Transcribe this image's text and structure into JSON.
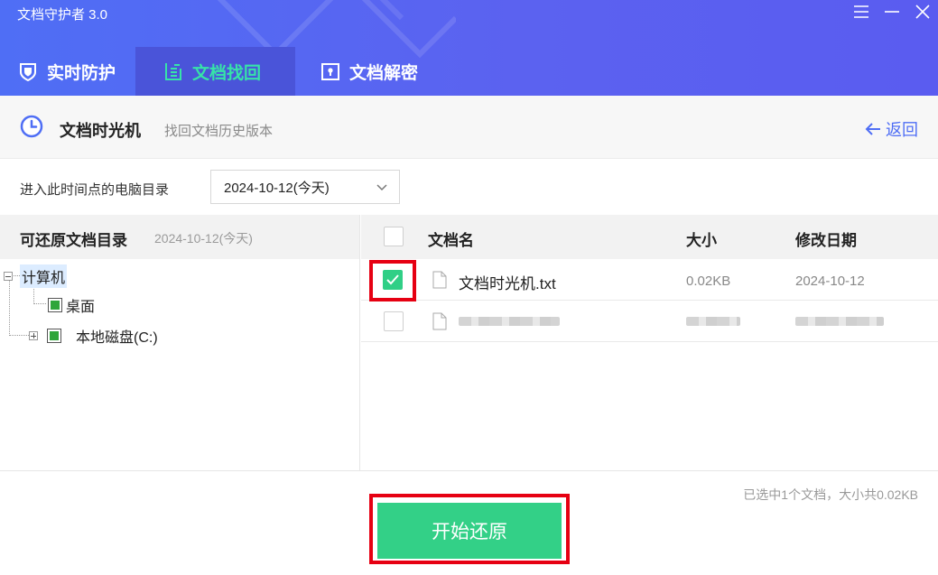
{
  "app": {
    "title": "文档守护者 3.0"
  },
  "tabs": [
    {
      "label": "实时防护",
      "icon": "shield-icon"
    },
    {
      "label": "文档找回",
      "icon": "document-recover-icon"
    },
    {
      "label": "文档解密",
      "icon": "document-decrypt-icon"
    }
  ],
  "active_tab": "文档找回",
  "subheader": {
    "title": "文档时光机",
    "description": "找回文档历史版本",
    "back_label": "返回"
  },
  "date_row": {
    "label": "进入此时间点的电脑目录",
    "selected": "2024-10-12(今天)"
  },
  "tree": {
    "title": "可还原文档目录",
    "date": "2024-10-12(今天)",
    "nodes": {
      "root": "计算机",
      "desktop": "桌面",
      "disk_c": "本地磁盘(C:)"
    }
  },
  "table": {
    "columns": {
      "name": "文档名",
      "size": "大小",
      "modified": "修改日期"
    },
    "rows": [
      {
        "name": "文档时光机.txt",
        "size": "0.02KB",
        "modified": "2024-10-12",
        "checked": true
      },
      {
        "name": "",
        "size": "",
        "modified": "",
        "checked": false,
        "blurred": true
      }
    ]
  },
  "footer": {
    "status": "已选中1个文档，大小共0.02KB",
    "start_label": "开始还原"
  },
  "colors": {
    "header_blue": "#4f6ef5",
    "active_tab_text": "#37e3a8",
    "green": "#33d087",
    "highlight_red": "#e60012"
  }
}
